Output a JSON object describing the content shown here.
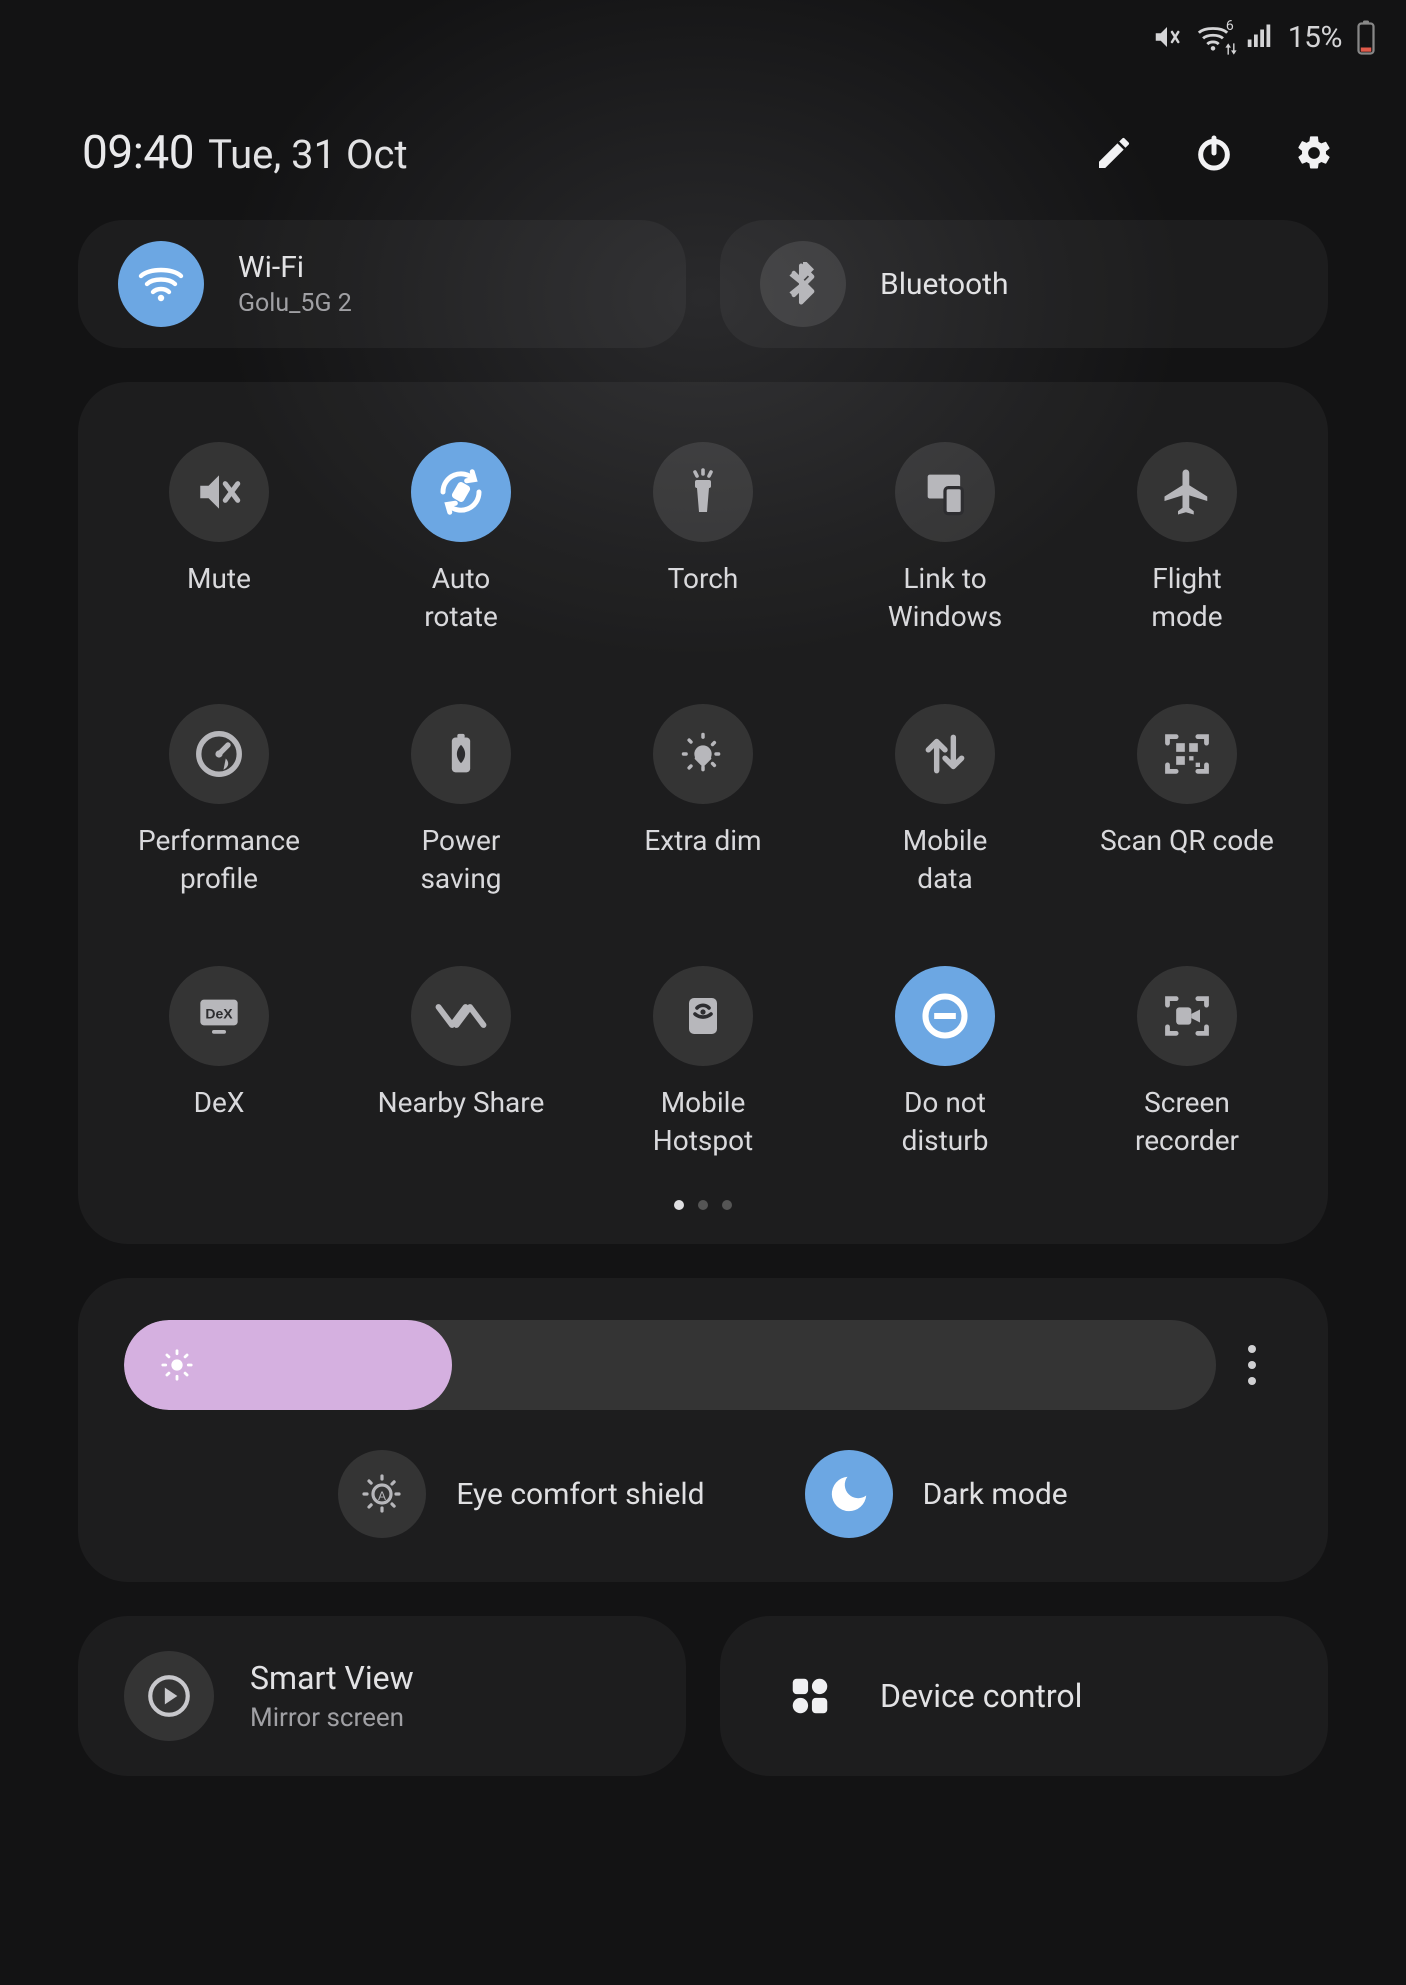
{
  "status_bar": {
    "icons": [
      "mute-icon",
      "wifi-signal-icon",
      "cellular-signal-icon"
    ],
    "battery_percent": "15%",
    "wifi_badge": "6"
  },
  "header": {
    "time": "09:40",
    "date": "Tue, 31 Oct",
    "actions": {
      "edit": "edit",
      "power": "power",
      "settings": "settings"
    }
  },
  "colors": {
    "accent": "#6ca7e3",
    "slider": "#d5b0e0"
  },
  "connectivity": {
    "wifi": {
      "title": "Wi-Fi",
      "subtitle": "Golu_5G 2",
      "enabled": true
    },
    "bluetooth": {
      "title": "Bluetooth",
      "subtitle": "",
      "enabled": false
    }
  },
  "tiles": {
    "pages": 3,
    "active_page": 0,
    "items": [
      {
        "id": "mute",
        "label": "Mute",
        "enabled": false
      },
      {
        "id": "auto-rotate",
        "label": "Auto\nrotate",
        "enabled": true
      },
      {
        "id": "torch",
        "label": "Torch",
        "enabled": false
      },
      {
        "id": "link-windows",
        "label": "Link to\nWindows",
        "enabled": false
      },
      {
        "id": "flight-mode",
        "label": "Flight\nmode",
        "enabled": false
      },
      {
        "id": "perf-profile",
        "label": "Performance\nprofile",
        "enabled": false
      },
      {
        "id": "power-saving",
        "label": "Power\nsaving",
        "enabled": false
      },
      {
        "id": "extra-dim",
        "label": "Extra dim",
        "enabled": false
      },
      {
        "id": "mobile-data",
        "label": "Mobile\ndata",
        "enabled": false
      },
      {
        "id": "scan-qr",
        "label": "Scan QR code",
        "enabled": false
      },
      {
        "id": "dex",
        "label": "DeX",
        "enabled": false
      },
      {
        "id": "nearby-share",
        "label": "Nearby Share",
        "enabled": false
      },
      {
        "id": "hotspot",
        "label": "Mobile\nHotspot",
        "enabled": false
      },
      {
        "id": "dnd",
        "label": "Do not\ndisturb",
        "enabled": true
      },
      {
        "id": "screen-rec",
        "label": "Screen\nrecorder",
        "enabled": false
      }
    ]
  },
  "brightness": {
    "percent": 30
  },
  "display_modes": {
    "eye_comfort": {
      "label": "Eye comfort shield",
      "enabled": false
    },
    "dark_mode": {
      "label": "Dark mode",
      "enabled": true
    }
  },
  "bottom": {
    "smart_view": {
      "title": "Smart View",
      "subtitle": "Mirror screen"
    },
    "device_control": {
      "title": "Device control"
    }
  }
}
